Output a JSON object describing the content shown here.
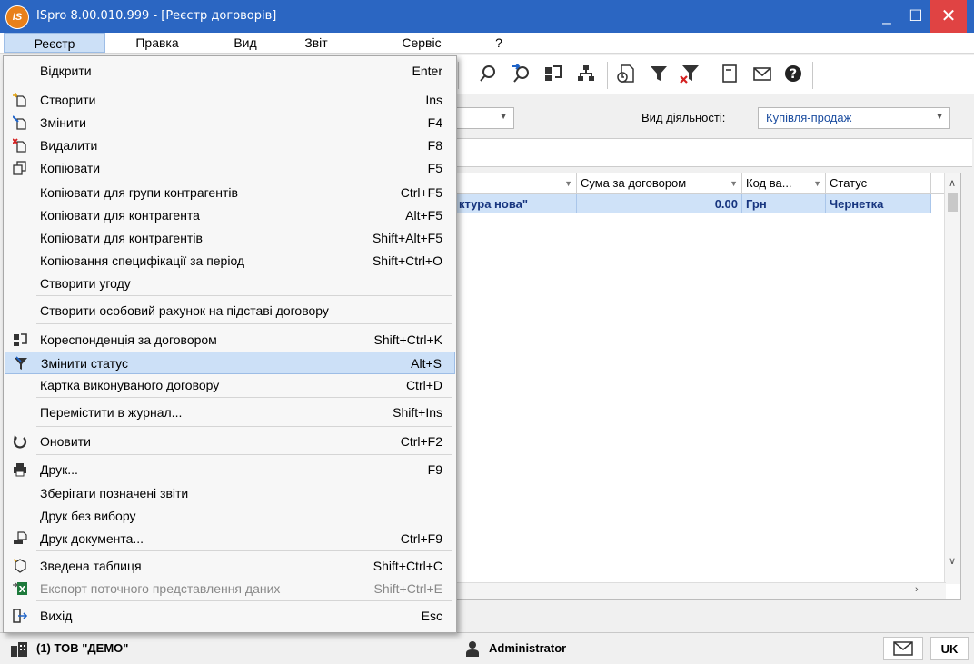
{
  "window": {
    "logo_text": "IS",
    "title": "ISpro 8.00.010.999 - [Реєстр договорів]",
    "min_glyph": "_",
    "max_glyph": "☐",
    "close_glyph": "✕"
  },
  "menubar": [
    "Реєстр",
    "Правка",
    "Вид",
    "Звіт",
    "Сервіс",
    "?"
  ],
  "filters": {
    "activity_label": "Вид діяльності:",
    "activity_value": "Купівля-продаж"
  },
  "grid": {
    "headers": [
      "",
      "Сума за договором",
      "Код ва...",
      "Статус"
    ],
    "row": [
      "ктура нова\"",
      "0.00",
      "Грн",
      "Чернетка"
    ]
  },
  "menu": {
    "items": [
      {
        "label": "Відкрити",
        "shortcut": "Enter",
        "icon": ""
      },
      {
        "label": "Створити",
        "shortcut": "Ins",
        "icon": "new-document-icon"
      },
      {
        "label": "Змінити",
        "shortcut": "F4",
        "icon": "edit-document-icon"
      },
      {
        "label": "Видалити",
        "shortcut": "F8",
        "icon": "delete-document-icon"
      },
      {
        "label": "Копіювати",
        "shortcut": "F5",
        "icon": "copy-icon"
      },
      {
        "label": "Копіювати для групи контрагентів",
        "shortcut": "Ctrl+F5",
        "icon": ""
      },
      {
        "label": "Копіювати для контрагента",
        "shortcut": "Alt+F5",
        "icon": ""
      },
      {
        "label": "Копіювати для контрагентів",
        "shortcut": "Shift+Alt+F5",
        "icon": ""
      },
      {
        "label": "Копіювання специфікації за період",
        "shortcut": "Shift+Ctrl+O",
        "icon": ""
      },
      {
        "label": "Створити угоду",
        "shortcut": "",
        "icon": ""
      },
      {
        "label": "Створити особовий рахунок на підставі договору",
        "shortcut": "",
        "icon": ""
      },
      {
        "label": "Кореспонденція за договором",
        "shortcut": "Shift+Ctrl+K",
        "icon": "correspondence-icon"
      },
      {
        "label": "Змінити статус",
        "shortcut": "Alt+S",
        "icon": "change-status-icon"
      },
      {
        "label": "Картка виконуваного договору",
        "shortcut": "Ctrl+D",
        "icon": ""
      },
      {
        "label": "Перемістити в журнал...",
        "shortcut": "Shift+Ins",
        "icon": ""
      },
      {
        "label": "Оновити",
        "shortcut": "Ctrl+F2",
        "icon": "refresh-icon"
      },
      {
        "label": "Друк...",
        "shortcut": "F9",
        "icon": "printer-icon"
      },
      {
        "label": "Зберігати позначені звіти",
        "shortcut": "",
        "icon": ""
      },
      {
        "label": "Друк без вибору",
        "shortcut": "",
        "icon": ""
      },
      {
        "label": "Друк документа...",
        "shortcut": "Ctrl+F9",
        "icon": "print-document-icon"
      },
      {
        "label": "Зведена таблиця",
        "shortcut": "Shift+Ctrl+C",
        "icon": "pivot-table-icon"
      },
      {
        "label": "Експорт поточного представлення даних",
        "shortcut": "Shift+Ctrl+E",
        "icon": "excel-export-icon"
      },
      {
        "label": "Вихід",
        "shortcut": "Esc",
        "icon": "exit-icon"
      }
    ],
    "highlighted_index": 12,
    "disabled_index": 21
  },
  "statusbar": {
    "org": "(1) ТОВ \"ДЕМО\"",
    "user": "Administrator",
    "lang": "UK"
  },
  "colors": {
    "titlebar": "#2b66c2",
    "selection": "#cce0f7",
    "close": "#e04343"
  }
}
